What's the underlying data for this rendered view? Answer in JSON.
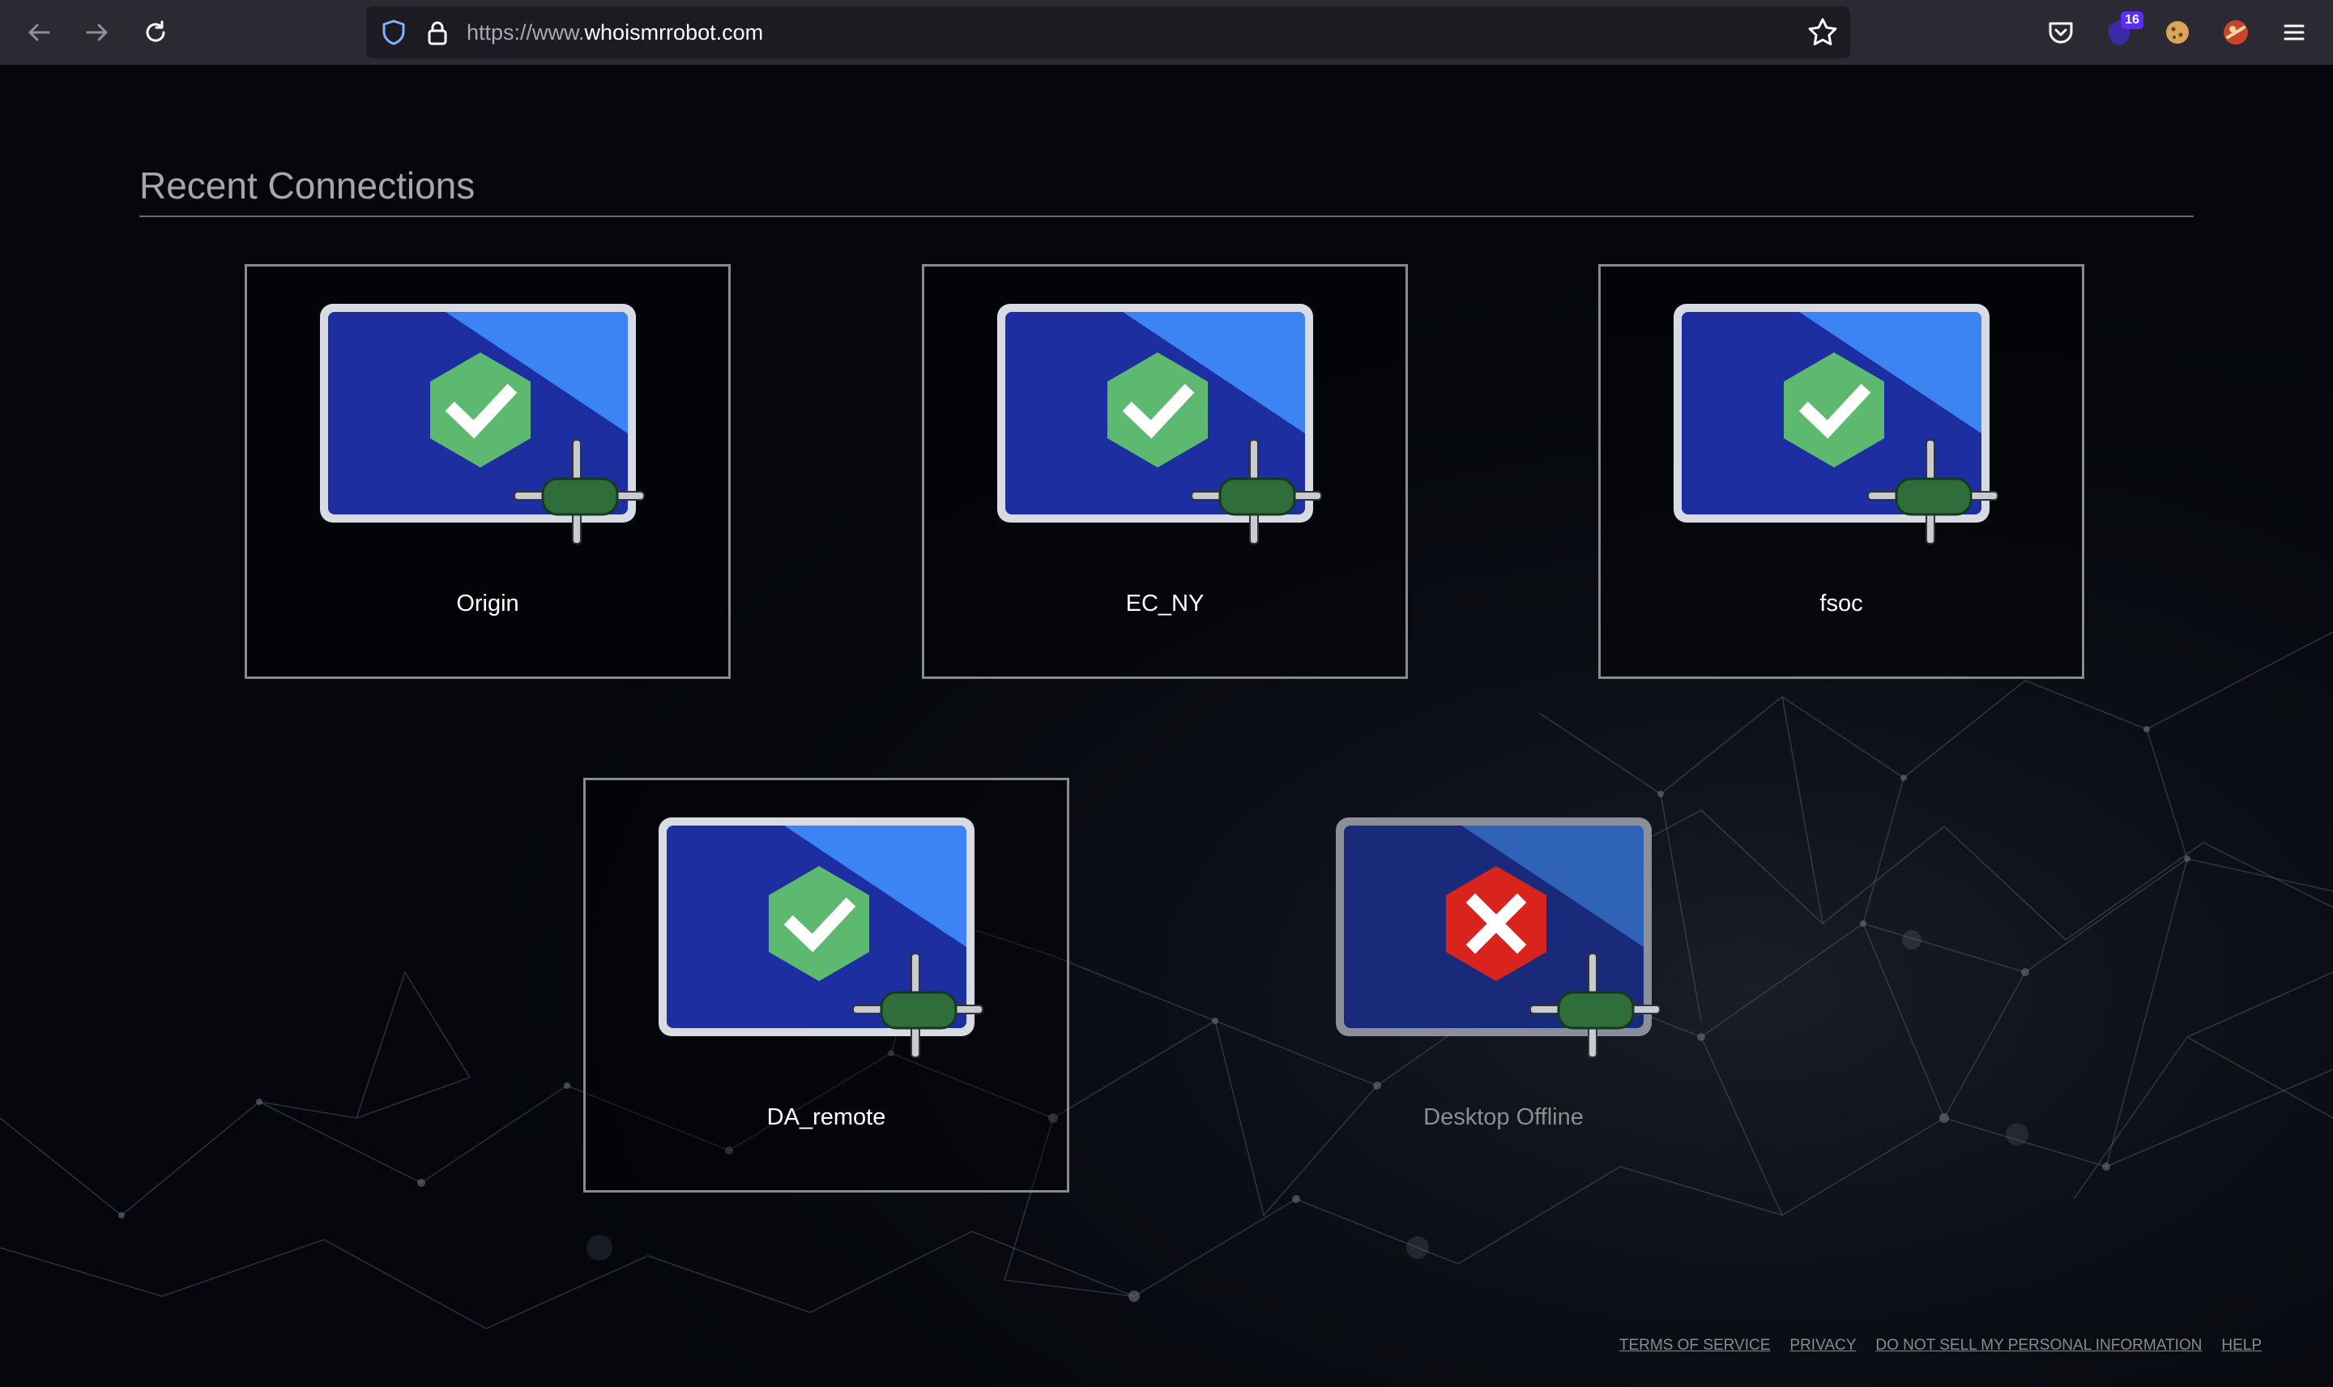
{
  "browser": {
    "url_scheme": "https://www.",
    "url_host": "whoismrrobot.com",
    "extension_badge": "16"
  },
  "page": {
    "section_title": "Recent Connections",
    "connections": [
      {
        "name": "Origin",
        "status": "online"
      },
      {
        "name": "EC_NY",
        "status": "online"
      },
      {
        "name": "fsoc",
        "status": "online"
      },
      {
        "name": "DA_remote",
        "status": "online"
      },
      {
        "name": "Desktop Offline",
        "status": "offline"
      }
    ]
  },
  "footer": {
    "terms": "TERMS OF SERVICE",
    "privacy": "PRIVACY",
    "do_not_sell": "DO NOT SELL MY PERSONAL INFORMATION",
    "help": "HELP"
  },
  "colors": {
    "online_hex": "#5cb96f",
    "offline_hex": "#d9231d",
    "screen_dark": "#1d2fa0",
    "screen_light": "#3c84f4"
  },
  "icons": {
    "online": "checkmark-hexagon-icon",
    "offline": "x-hexagon-icon",
    "connector": "network-connector-icon"
  }
}
